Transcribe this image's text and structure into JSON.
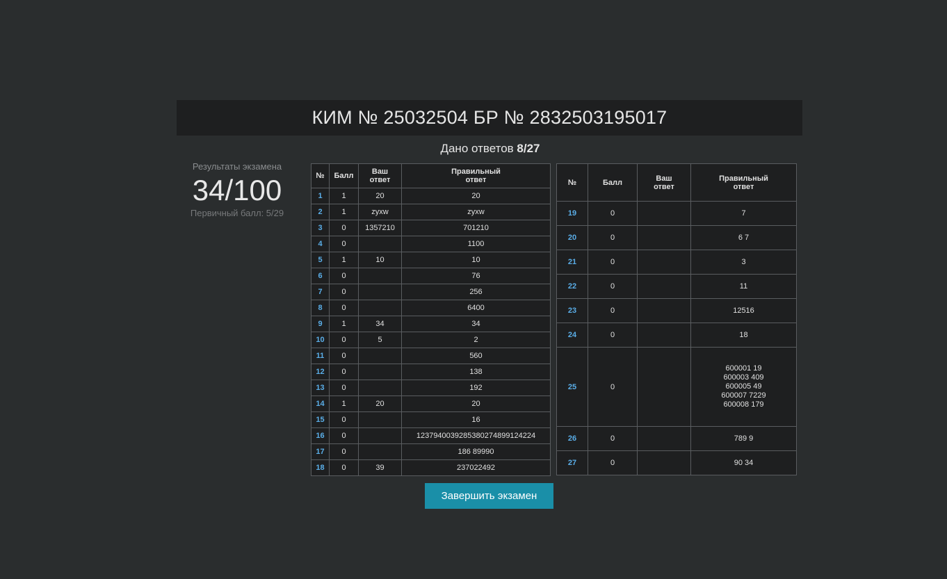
{
  "header": {
    "title": "КИМ № 25032504 БР № 2832503195017"
  },
  "answers_given": {
    "label": "Дано ответов",
    "value": "8/27"
  },
  "result": {
    "label": "Результаты экзамена",
    "score": "34/100",
    "primary": "Первичный балл: 5/29"
  },
  "table": {
    "columns": [
      "№",
      "Балл",
      "Ваш ответ",
      "Правильный ответ"
    ],
    "left_rows": [
      {
        "num": "1",
        "score": "1",
        "yours": "20",
        "correct": "20"
      },
      {
        "num": "2",
        "score": "1",
        "yours": "zyxw",
        "correct": "zyxw"
      },
      {
        "num": "3",
        "score": "0",
        "yours": "1357210",
        "correct": "701210"
      },
      {
        "num": "4",
        "score": "0",
        "yours": "",
        "correct": "1100"
      },
      {
        "num": "5",
        "score": "1",
        "yours": "10",
        "correct": "10"
      },
      {
        "num": "6",
        "score": "0",
        "yours": "",
        "correct": "76"
      },
      {
        "num": "7",
        "score": "0",
        "yours": "",
        "correct": "256"
      },
      {
        "num": "8",
        "score": "0",
        "yours": "",
        "correct": "6400"
      },
      {
        "num": "9",
        "score": "1",
        "yours": "34",
        "correct": "34"
      },
      {
        "num": "10",
        "score": "0",
        "yours": "5",
        "correct": "2"
      },
      {
        "num": "11",
        "score": "0",
        "yours": "",
        "correct": "560"
      },
      {
        "num": "12",
        "score": "0",
        "yours": "",
        "correct": "138"
      },
      {
        "num": "13",
        "score": "0",
        "yours": "",
        "correct": "192"
      },
      {
        "num": "14",
        "score": "1",
        "yours": "20",
        "correct": "20"
      },
      {
        "num": "15",
        "score": "0",
        "yours": "",
        "correct": "16"
      },
      {
        "num": "16",
        "score": "0",
        "yours": "",
        "correct": "12379400392853802748991242​24"
      },
      {
        "num": "17",
        "score": "0",
        "yours": "",
        "correct": "186 89990"
      },
      {
        "num": "18",
        "score": "0",
        "yours": "39",
        "correct": "237022492"
      }
    ],
    "right_rows": [
      {
        "num": "19",
        "score": "0",
        "yours": "",
        "correct": "7"
      },
      {
        "num": "20",
        "score": "0",
        "yours": "",
        "correct": "6 7"
      },
      {
        "num": "21",
        "score": "0",
        "yours": "",
        "correct": "3"
      },
      {
        "num": "22",
        "score": "0",
        "yours": "",
        "correct": "11"
      },
      {
        "num": "23",
        "score": "0",
        "yours": "",
        "correct": "12516"
      },
      {
        "num": "24",
        "score": "0",
        "yours": "",
        "correct": "18"
      },
      {
        "num": "25",
        "score": "0",
        "yours": "",
        "correct": "600001 19\n600003 409\n600005 49\n600007 7229\n600008 179"
      },
      {
        "num": "26",
        "score": "0",
        "yours": "",
        "correct": "789 9"
      },
      {
        "num": "27",
        "score": "0",
        "yours": "",
        "correct": "90 34"
      }
    ]
  },
  "finish_button": {
    "label": "Завершить экзамен"
  },
  "colors": {
    "background": "#2a2d2e",
    "panel": "#1e1f20",
    "accent": "#1a8fa8",
    "number_link": "#5aaee8"
  }
}
